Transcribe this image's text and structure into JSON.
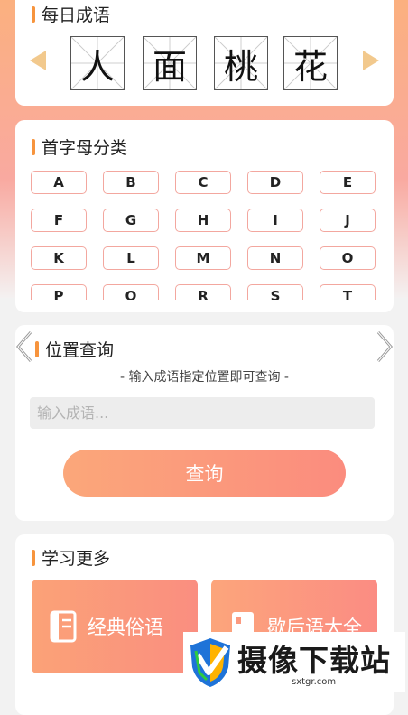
{
  "daily_idiom": {
    "title": "每日成语",
    "characters": [
      "人",
      "面",
      "桃",
      "花"
    ]
  },
  "letter_category": {
    "title": "首字母分类",
    "letters": [
      "A",
      "B",
      "C",
      "D",
      "E",
      "F",
      "G",
      "H",
      "I",
      "J",
      "K",
      "L",
      "M",
      "N",
      "O",
      "P",
      "Q",
      "R",
      "S",
      "T"
    ]
  },
  "position_query": {
    "title": "位置查询",
    "subtitle": "- 输入成语指定位置即可查询 -",
    "input_placeholder": "输入成语...",
    "button_label": "查询"
  },
  "learn_more": {
    "title": "学习更多",
    "items": [
      {
        "label": "经典俗语",
        "icon": "book-icon"
      },
      {
        "label": "歇后语大全",
        "icon": "notebook-icon"
      }
    ]
  },
  "watermark": {
    "brand": "摄像下载站",
    "url": "sxtgr.com"
  },
  "colors": {
    "accent": "#f7943d",
    "button_start": "#fba77a",
    "button_end": "#fb8c7e",
    "letter_border": "#f3a79f"
  }
}
